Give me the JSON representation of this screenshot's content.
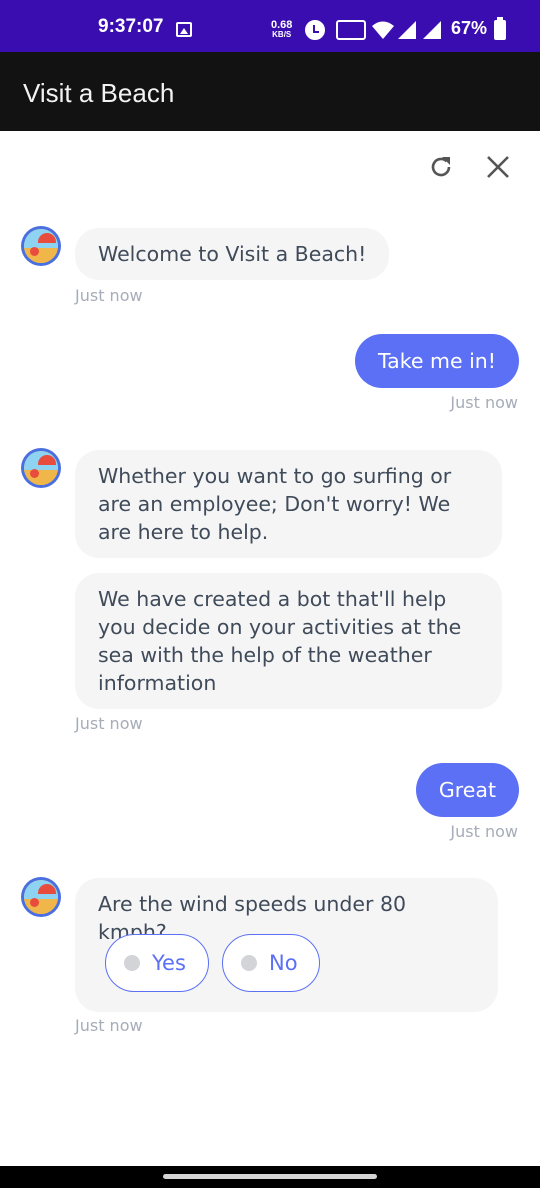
{
  "status_bar": {
    "time": "9:37:07",
    "net_speed_value": "0.68",
    "net_speed_unit": "KB/S",
    "vowifi_label": "Vo WiFi 2",
    "battery": "67%"
  },
  "app_bar": {
    "title": "Visit a Beach"
  },
  "chat_toolbar": {
    "refresh_icon": "refresh-icon",
    "close_icon": "close-icon"
  },
  "messages": [
    {
      "from": "bot",
      "text": "Welcome to Visit a Beach!",
      "time": "Just now"
    },
    {
      "from": "user",
      "text": "Take me in!",
      "time": "Just now"
    },
    {
      "from": "bot",
      "text": "Whether you want to go surfing or are an employee; Don't worry! We are here to help."
    },
    {
      "from": "bot",
      "text": "We have created a bot that'll help you decide on your activities at the sea with the help of the weather information",
      "time": "Just now"
    },
    {
      "from": "user",
      "text": "Great",
      "time": "Just now"
    },
    {
      "from": "bot",
      "text": "Are the wind speeds under 80 kmph?",
      "time": "Just now",
      "options": [
        "Yes",
        "No"
      ]
    }
  ],
  "colors": {
    "status_bar": "#3a0db1",
    "app_bar": "#121212",
    "user_bubble": "#5b70f5",
    "bot_bubble": "#f5f5f6"
  }
}
